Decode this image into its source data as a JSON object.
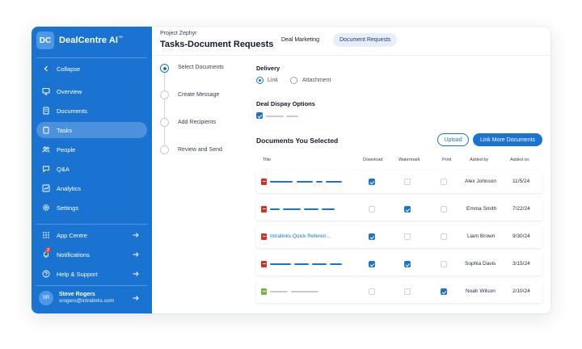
{
  "sidebar": {
    "logo_initials": "DC",
    "brand": "DealCentre AI",
    "trademark": "™",
    "collapse": "Collapse",
    "items": [
      {
        "label": "Overview",
        "icon": "monitor-icon"
      },
      {
        "label": "Documents",
        "icon": "document-icon"
      },
      {
        "label": "Tasks",
        "icon": "clipboard-icon",
        "active": true
      },
      {
        "label": "People",
        "icon": "people-icon"
      },
      {
        "label": "Q&A",
        "icon": "chat-icon"
      },
      {
        "label": "Analytics",
        "icon": "chart-icon"
      },
      {
        "label": "Settings",
        "icon": "gear-icon"
      }
    ],
    "bottom": [
      {
        "label": "App Centre",
        "icon": "grid-icon"
      },
      {
        "label": "Notifications",
        "icon": "bell-icon",
        "badge": "2"
      },
      {
        "label": "Help & Support",
        "icon": "help-icon"
      }
    ],
    "user": {
      "initials": "SR",
      "name": "Steve Rogers",
      "email": "srogers@intralinks.com"
    }
  },
  "header": {
    "project": "Project Zephyr",
    "title": "Tasks-Document Requests",
    "tabs": [
      {
        "label": "Deal Marketing",
        "active": false
      },
      {
        "label": "Document Requests",
        "active": true
      }
    ]
  },
  "steps": [
    "Select Documents",
    "Create Message",
    "Add Recipients",
    "Review and Send"
  ],
  "delivery": {
    "label": "Delivery",
    "options": [
      {
        "label": "Link",
        "checked": true
      },
      {
        "label": "Attachment",
        "checked": false
      }
    ]
  },
  "display_options": {
    "label": "Deal Dispay Options"
  },
  "documents": {
    "title": "Documents You Selected",
    "upload_label": "Upload",
    "link_more_label": "Link More Documents",
    "columns": [
      "Title",
      "Download",
      "Watermark",
      "Print",
      "Added by",
      "Added on"
    ],
    "rows": [
      {
        "type": "pdf",
        "title": "",
        "download": true,
        "watermark": false,
        "print": false,
        "added_by": "Alex Johnson",
        "added_on": "11/5/24"
      },
      {
        "type": "pdf",
        "title": "",
        "download": false,
        "watermark": true,
        "print": false,
        "added_by": "Emma Smith",
        "added_on": "7/22/24"
      },
      {
        "type": "pdf",
        "title": "Intralinks Quick Referen...",
        "download": true,
        "watermark": false,
        "print": false,
        "added_by": "Liam Brown",
        "added_on": "9/30/24"
      },
      {
        "type": "pdf",
        "title": "",
        "download": true,
        "watermark": true,
        "print": false,
        "added_by": "Sophia Davis",
        "added_on": "3/15/24"
      },
      {
        "type": "xls",
        "title": "",
        "download": false,
        "watermark": false,
        "print": true,
        "added_by": "Noah Wilson",
        "added_on": "2/10/24"
      }
    ]
  },
  "colors": {
    "primary": "#1a73d1",
    "sidebar": "#1a73d1",
    "pdf": "#d93025",
    "xls": "#7cb342"
  }
}
